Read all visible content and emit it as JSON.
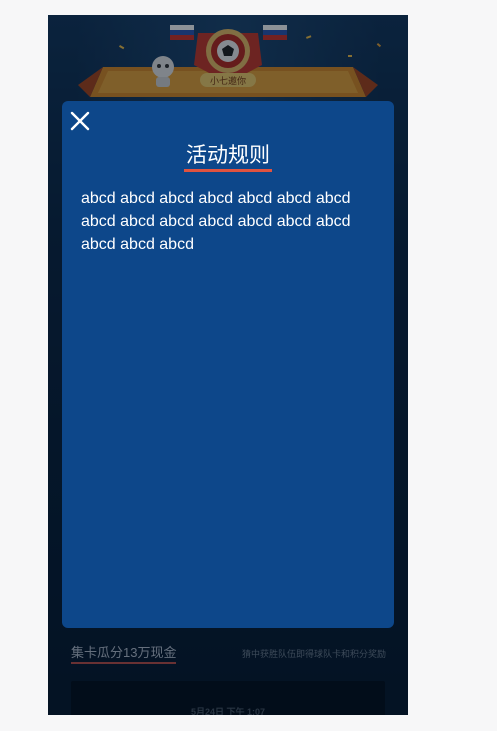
{
  "background": {
    "collect_title": "集卡瓜分13万现金",
    "collect_desc": "猜中获胜队伍即得球队卡和积分奖励",
    "card_time": "5月24日 下午 1:07",
    "banner_label": "小七邀你"
  },
  "modal": {
    "close_icon": "close-icon",
    "title": "活动规则",
    "body": "abcd abcd abcd abcd abcd abcd abcd abcd abcd abcd abcd abcd abcd abcd abcd abcd abcd"
  },
  "colors": {
    "modal_bg": "#0d478a",
    "title_underline": "#e0533f",
    "page_bg": "#0a1f36",
    "outer_bg": "#f7f7f8"
  }
}
